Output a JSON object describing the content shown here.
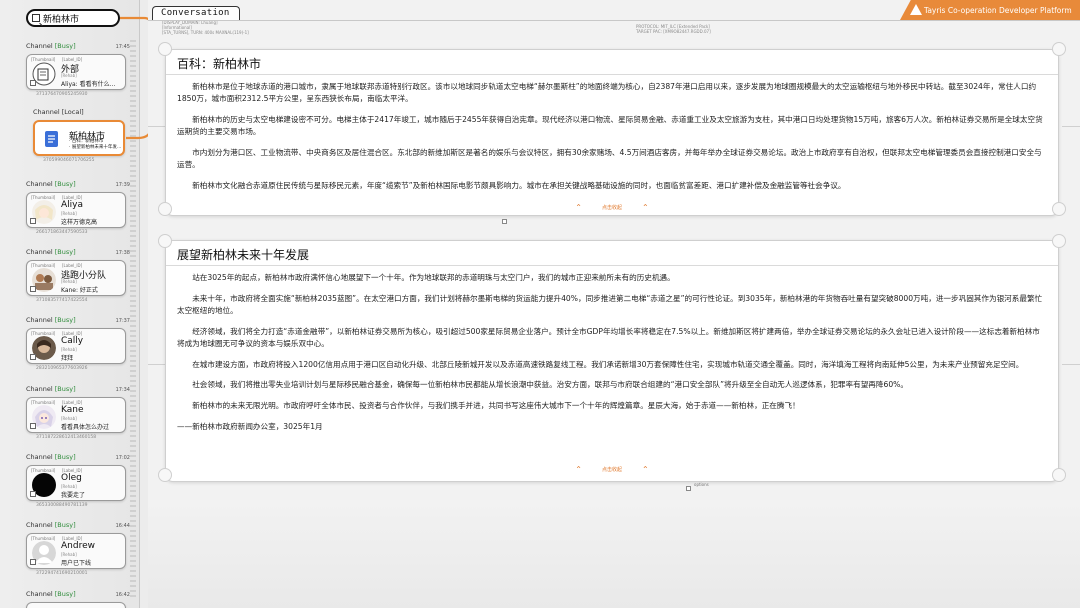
{
  "sidebar": {
    "search": {
      "value": "新柏林市"
    },
    "channels": [
      {
        "tag_prefix": "Channel ",
        "status": "[Busy]",
        "time": "17:45",
        "placeholder": "[Thumbnail]",
        "sub_placeholder": "[Label_ID]",
        "name": "外部",
        "sub": "[Rehab]",
        "msg": "Aliya: 看看有什么…",
        "id": "371376470905245930",
        "avatar": "note-avatar"
      },
      {
        "tag_prefix": "Channel ",
        "status": "[Local]",
        "time": "",
        "placeholder": "",
        "sub_placeholder": "",
        "name": "新柏林市",
        "sub": "",
        "msg": "· 百科：新柏林市\n· 展望新柏林未来十年发…",
        "id": "370599046071706255",
        "avatar": "doc-avatar"
      },
      {
        "tag_prefix": "Channel ",
        "status": "[Busy]",
        "time": "17:39",
        "placeholder": "[Thumbnail]",
        "sub_placeholder": "[Label_ID]",
        "name": "Aliya",
        "sub": "[Rehab]",
        "msg": "这样万德克高",
        "id": "266171863447590533",
        "avatar": "anime-avatar"
      },
      {
        "tag_prefix": "Channel ",
        "status": "[Busy]",
        "time": "17:38",
        "placeholder": "[Thumbnail]",
        "sub_placeholder": "[Label_ID]",
        "name": "逃跑小分队",
        "sub": "[Rehab]",
        "msg": "Kane: 好正式",
        "id": "371083577417422554",
        "avatar": "group-avatar"
      },
      {
        "tag_prefix": "Channel ",
        "status": "[Busy]",
        "time": "17:37",
        "placeholder": "[Thumbnail]",
        "sub_placeholder": "[Label_ID]",
        "name": "Cally",
        "sub": "[Rehab]",
        "msg": "拜拜",
        "id": "283210965377603926",
        "avatar": "portrait-avatar"
      },
      {
        "tag_prefix": "Channel ",
        "status": "[Busy]",
        "time": "17:34",
        "placeholder": "[Thumbnail]",
        "sub_placeholder": "[Label_ID]",
        "name": "Kane",
        "sub": "[Rehab]",
        "msg": "看看具体怎么办过",
        "id": "371187228612413460158",
        "avatar": "anime2-avatar"
      },
      {
        "tag_prefix": "Channel ",
        "status": "[Busy]",
        "time": "17:02",
        "placeholder": "[Thumbnail]",
        "sub_placeholder": "[Label_ID]",
        "name": "Oleg",
        "sub": "[Rehab]",
        "msg": "我要走了",
        "id": "365330088490781139",
        "avatar": "black-avatar"
      },
      {
        "tag_prefix": "Channel ",
        "status": "[Busy]",
        "time": "16:44",
        "placeholder": "[Thumbnail]",
        "sub_placeholder": "[Label_ID]",
        "name": "Andrew",
        "sub": "[Rehab]",
        "msg": "用户已下线",
        "id": "372294741690210001",
        "avatar": "person-avatar"
      },
      {
        "tag_prefix": "Channel ",
        "status": "[Busy]",
        "time": "16:42",
        "placeholder": "",
        "sub_placeholder": "",
        "name": "",
        "sub": "",
        "msg": "",
        "id": "",
        "avatar": ""
      }
    ]
  },
  "main": {
    "tab": "Conversation",
    "meta_left": [
      "[DISPLAY_DOMAIN: Lhuang]",
      "[Informational]",
      "[STA_TURNS], TURN: 400s MAXNAL(119)-1]"
    ],
    "meta_right": [
      "PROTOCOL: MIT_ILC [Extended Pack]",
      "TARGET PAC: [XM9O82447.RGDD.07]"
    ],
    "brand": "Tayris Co-operation Developer Platform",
    "panels": [
      {
        "title": "百科：新柏林市",
        "paragraphs": [
          "新柏林市是位于地球赤道的港口城市，隶属于地球联邦赤道特别行政区。该市以地球同步轨道太空电梯“赫尔墨斯柱”的地面终端为核心，自2387年港口启用以来，逐步发展为地球圈规模最大的太空运输枢纽与地外移民中转站。截至3024年，常住人口约1850万，城市面积2312.5平方公里，呈东西狭长布局，南临太平洋。",
          "新柏林市的历史与太空电梯建设密不可分。电梯主体于2417年竣工，城市随后于2455年获得自治宪章。现代经济以港口物流、星际贸易金融、赤道重工业及太空旅游为支柱，其中港口日均处理货物15万吨，旅客6万人次。新柏林证券交易所是全球太空货运期货的主要交易市场。",
          "市内划分为港口区、工业物流带、中央商务区及居住混合区。东北部的新维加斯区是著名的娱乐与会议特区，拥有30余家赌场、4.5万间酒店客房，并每年举办全球证券交易论坛。政治上市政府享有自治权，但联邦太空电梯管理委员会直接控制港口安全与运营。",
          "新柏林市文化融合赤道原住民传统与星际移民元素，年度“缆索节”及新柏林国际电影节颇具影响力。城市在承担关键战略基础设施的同时，也面临贫富差距、港口扩建补偿及金融监管等社会争议。"
        ],
        "collapse": "点击收起"
      },
      {
        "title": "展望新柏林未来十年发展",
        "paragraphs": [
          "站在3025年的起点，新柏林市政府满怀信心地展望下一个十年。作为地球联邦的赤道明珠与太空门户，我们的城市正迎来前所未有的历史机遇。",
          "未来十年，市政府将全面实施“新柏林2035蓝图”。在太空港口方面，我们计划将赫尔墨斯电梯的货运能力提升40%，同步推进第二电梯“赤道之星”的可行性论证。到3035年，新柏林港的年货物吞吐量有望突破8000万吨，进一步巩固其作为银河系最繁忙太空枢纽的地位。",
          "经济领域，我们将全力打造“赤道金融带”，以新柏林证券交易所为核心，吸引超过500家星际贸易企业落户。预计全市GDP年均增长率将稳定在7.5%以上。新维加斯区将扩建两倍，举办全球证券交易论坛的永久会址已进入设计阶段——这标志着新柏林市将成为地球圈无可争议的资本与娱乐双中心。",
          "在城市建设方面，市政府将投入1200亿信用点用于港口区自动化升级、北部丘陵新城开发以及赤道高速铁路复线工程。我们承诺新增30万套保障性住宅，实现城市轨道交通全覆盖。同时，海洋填海工程将向南延伸5公里，为未来产业预留充足空间。",
          "社会领域，我们将推出零失业培训计划与星际移民融合基金，确保每一位新柏林市民都能从增长浪潮中获益。治安方面，联邦与市府联合组建的“港口安全部队”将升级至全自动无人巡逻体系，犯罪率有望再降60%。",
          "新柏林市的未来无限光明。市政府呼吁全体市民、投资者与合作伙伴，与我们携手并进，共同书写这座伟大城市下一个十年的辉煌篇章。星辰大海，始于赤道——新柏林，正在腾飞！"
        ],
        "signature": "——新柏林市政府新闻办公室，3025年1月",
        "collapse": "点击收起"
      }
    ],
    "options_label": "options"
  }
}
